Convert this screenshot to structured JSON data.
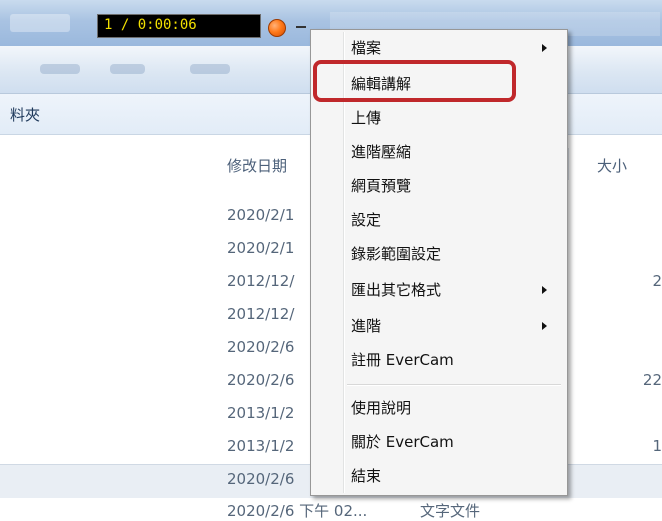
{
  "recorder": {
    "timer": "1 / 0:00:06"
  },
  "explorer": {
    "folder_label": "料夾",
    "columns": {
      "modified": "修改日期",
      "size": "大小"
    },
    "rows": [
      {
        "date": "2020/2/1",
        "size": ""
      },
      {
        "date": "2020/2/1",
        "size": ""
      },
      {
        "date": "2012/12/",
        "size": "2"
      },
      {
        "date": "2012/12/",
        "size": ""
      },
      {
        "date": "2020/2/6",
        "size": ""
      },
      {
        "date": "2020/2/6",
        "size": "22"
      },
      {
        "date": "2013/1/2",
        "size": ""
      },
      {
        "date": "2013/1/2",
        "size": "1"
      },
      {
        "date": "2020/2/6",
        "size": ""
      }
    ],
    "bottom_row": {
      "date": "2020/2/6 下午 02...",
      "type": "文字文件"
    }
  },
  "context_menu": {
    "items": [
      {
        "label": "檔案",
        "submenu": true
      },
      {
        "label": "編輯講解",
        "submenu": false
      },
      {
        "label": "上傳",
        "submenu": false
      },
      {
        "label": "進階壓縮",
        "submenu": false
      },
      {
        "label": "網頁預覽",
        "submenu": false
      },
      {
        "label": "設定",
        "submenu": false
      },
      {
        "label": "錄影範圍設定",
        "submenu": false
      },
      {
        "label": "匯出其它格式",
        "submenu": true
      },
      {
        "label": "進階",
        "submenu": true
      },
      {
        "label": "註冊 EverCam",
        "submenu": false
      },
      {
        "label": "使用說明",
        "submenu": false
      },
      {
        "label": "關於 EverCam",
        "submenu": false
      },
      {
        "label": "結束",
        "submenu": false
      }
    ],
    "highlighted_item": "編輯講解",
    "highlight_color": "#c0282b"
  }
}
